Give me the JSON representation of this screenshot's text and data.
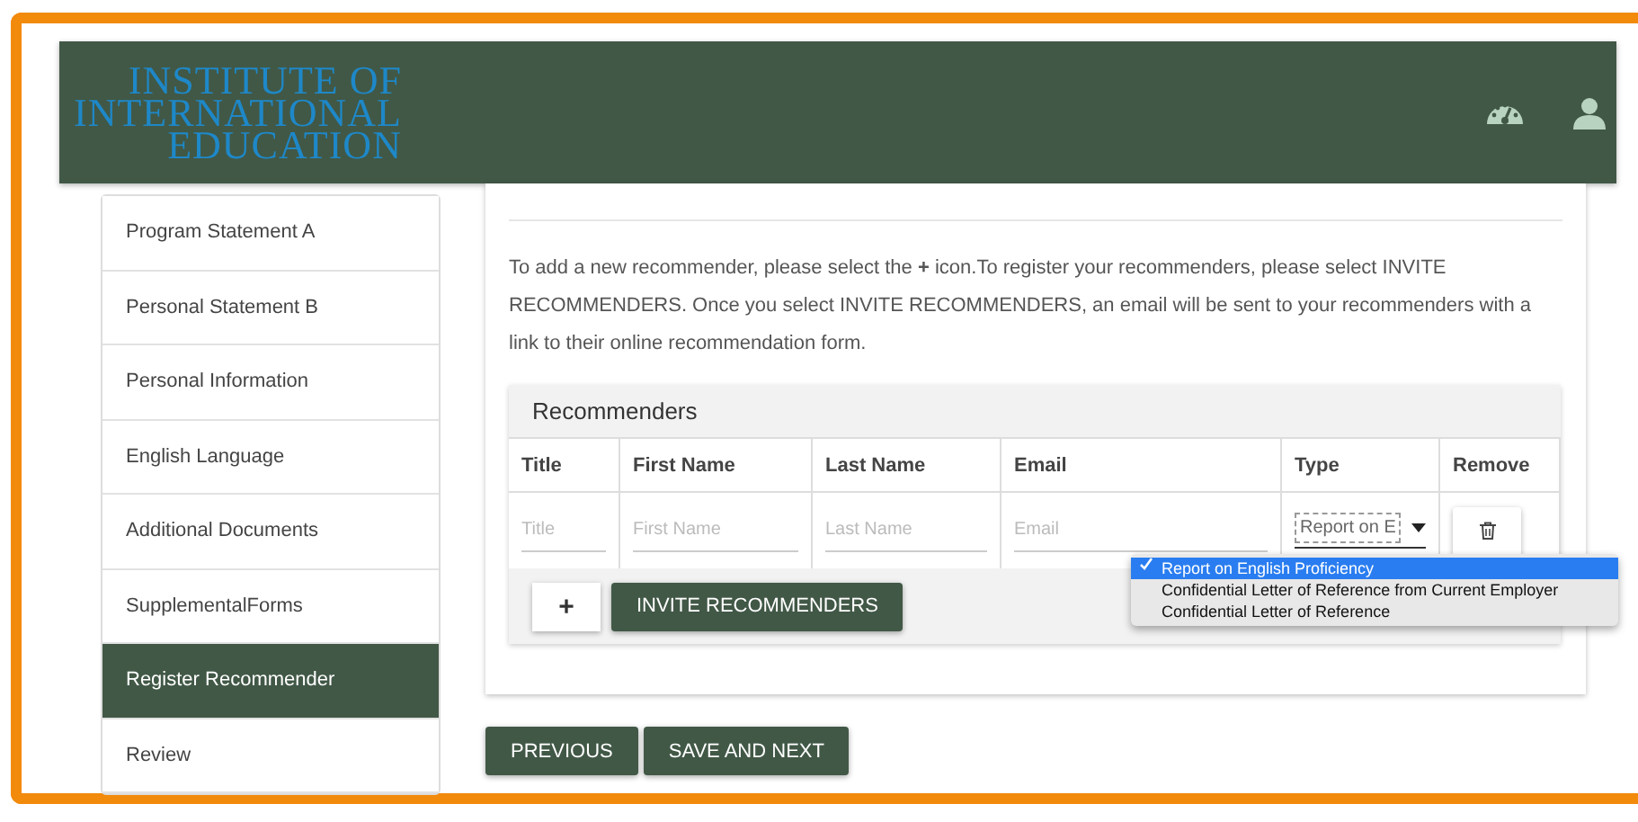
{
  "header": {
    "logo_lines": [
      "INSTITUTE OF",
      "INTERNATIONAL",
      "EDUCATION"
    ]
  },
  "sidebar": {
    "items": [
      {
        "label": "Program Statement A",
        "selected": false
      },
      {
        "label": "Personal Statement B",
        "selected": false
      },
      {
        "label": "Personal Information",
        "selected": false
      },
      {
        "label": "English Language",
        "selected": false
      },
      {
        "label": "Additional Documents",
        "selected": false
      },
      {
        "label": "SupplementalForms",
        "selected": false
      },
      {
        "label": "Register Recommender",
        "selected": true
      },
      {
        "label": "Review",
        "selected": false
      }
    ]
  },
  "instructions": "To add a new recommender, please select the **+** icon.To register your recommenders, please select INVITE RECOMMENDERS. Once you select INVITE RECOMMENDERS, an email will be sent to your recommenders with a link to their online recommendation form.",
  "table": {
    "title": "Recommenders",
    "columns": [
      "Title",
      "First Name",
      "Last Name",
      "Email",
      "Type",
      "Remove"
    ],
    "row": {
      "title": {
        "placeholder": "Title"
      },
      "first_name": {
        "placeholder": "First Name"
      },
      "last_name": {
        "placeholder": "Last Name"
      },
      "email": {
        "placeholder": "Email"
      },
      "type": "Report on E"
    },
    "type_options": [
      {
        "label": "Report on English Proficiency",
        "selected": true
      },
      {
        "label": "Confidential Letter of Reference from Current Employer",
        "selected": false
      },
      {
        "label": "Confidential Letter of Reference",
        "selected": false
      }
    ],
    "add_button": "+",
    "invite_button": "INVITE RECOMMENDERS"
  },
  "buttons": [
    "PREVIOUS",
    "SAVE AND NEXT"
  ]
}
